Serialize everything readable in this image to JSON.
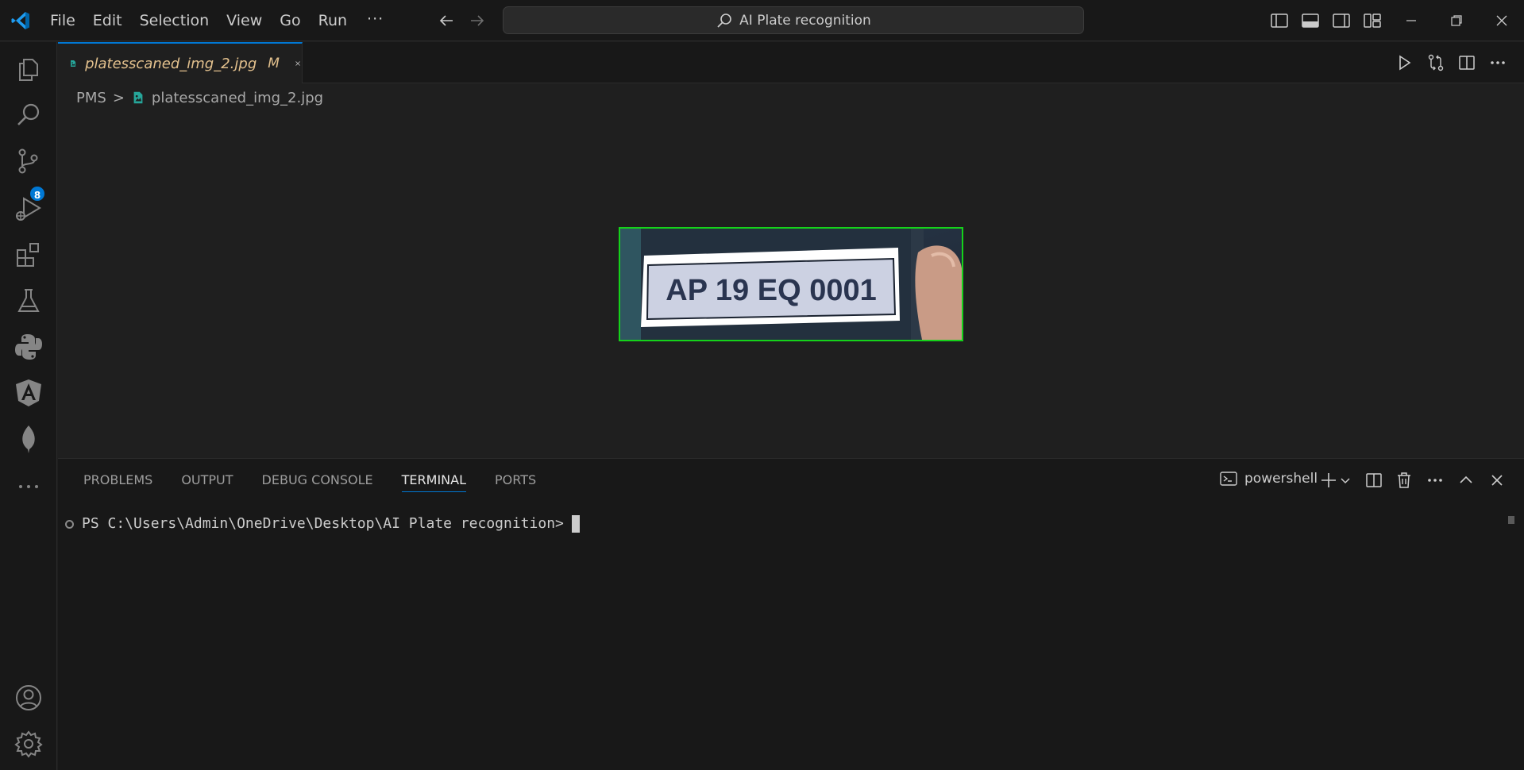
{
  "titlebar": {
    "menu": [
      "File",
      "Edit",
      "Selection",
      "View",
      "Go",
      "Run"
    ],
    "more": "···",
    "command_center": "AI Plate recognition"
  },
  "activitybar": {
    "icons": [
      "explorer-icon",
      "search-icon",
      "source-control-icon",
      "run-debug-icon",
      "extensions-icon",
      "testing-icon",
      "python-icon",
      "angular-icon",
      "mongodb-leaf-icon",
      "more-icon",
      "accounts-icon",
      "manage-gear-icon"
    ],
    "scm_badge": "8"
  },
  "editor": {
    "tab": {
      "title": "platesscaned_img_2.jpg",
      "status": "M"
    },
    "breadcrumb": {
      "folder": "PMS",
      "sep": ">",
      "file": "platesscaned_img_2.jpg"
    }
  },
  "image": {
    "plate_text": "AP 19 EQ 0001",
    "border_color": "#15d21a"
  },
  "panel": {
    "tabs": [
      "PROBLEMS",
      "OUTPUT",
      "DEBUG CONSOLE",
      "TERMINAL",
      "PORTS"
    ],
    "active_tab": "TERMINAL",
    "shell": "powershell",
    "prompt": "PS C:\\Users\\Admin\\OneDrive\\Desktop\\AI Plate recognition>"
  },
  "colors": {
    "accent": "#0078d4",
    "modified": "#e2c08d",
    "bg": "#1f1f1f",
    "chrome": "#181818"
  }
}
